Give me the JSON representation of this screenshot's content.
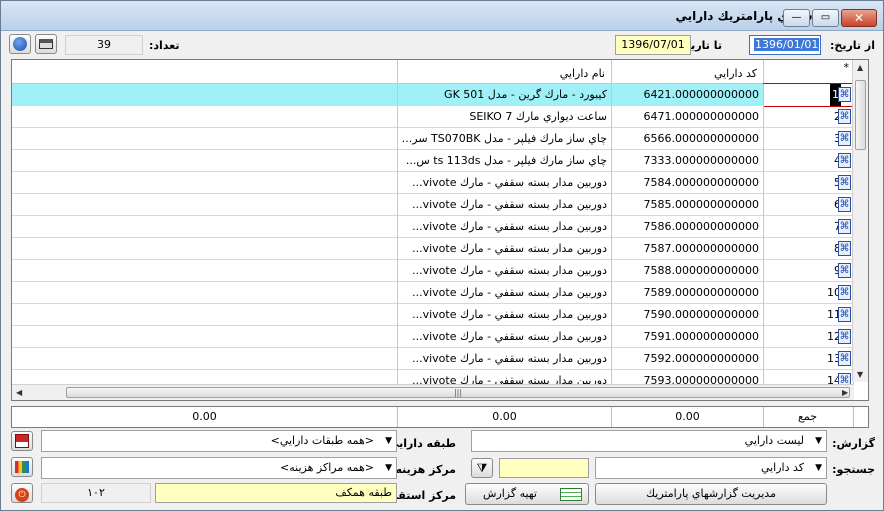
{
  "window": {
    "title": "گزارشهاي پارامتريك دارايي",
    "close_label": "✕",
    "max_label": "▭",
    "min_label": "—"
  },
  "filters": {
    "from_date_label": "از تاريخ:",
    "from_date_value": "1396/01/01",
    "to_date_label": "تا تاريخ:",
    "to_date_value": "1396/07/01",
    "count_label": "تعداد:",
    "count_value": "39"
  },
  "grid": {
    "columns": {
      "index": "*",
      "code": "كد دارايي",
      "name": "نام دارايي"
    },
    "rows": [
      {
        "idx": "1",
        "code": "6421.000000000000",
        "name": "كيبورد - مارك گرين - مدل GK 501",
        "selected": true
      },
      {
        "idx": "2",
        "code": "6471.000000000000",
        "name": "ساعت ديواري مارك SEIKO 7"
      },
      {
        "idx": "3",
        "code": "6566.000000000000",
        "name": "چاي ساز مارك فيلپر - مدل TS070BK سر..."
      },
      {
        "idx": "4",
        "code": "7333.000000000000",
        "name": "چاي ساز مارك فيلپر - مدل ts 113ds س..."
      },
      {
        "idx": "5",
        "code": "7584.000000000000",
        "name": "دوربين مدار بسته سقفي - مارك vivote..."
      },
      {
        "idx": "6",
        "code": "7585.000000000000",
        "name": "دوربين مدار بسته سقفي - مارك vivote..."
      },
      {
        "idx": "7",
        "code": "7586.000000000000",
        "name": "دوربين مدار بسته سقفي - مارك vivote..."
      },
      {
        "idx": "8",
        "code": "7587.000000000000",
        "name": "دوربين مدار بسته سقفي - مارك vivote..."
      },
      {
        "idx": "9",
        "code": "7588.000000000000",
        "name": "دوربين مدار بسته سقفي - مارك vivote..."
      },
      {
        "idx": "10",
        "code": "7589.000000000000",
        "name": "دوربين مدار بسته سقفي - مارك vivote..."
      },
      {
        "idx": "11",
        "code": "7590.000000000000",
        "name": "دوربين مدار بسته سقفي - مارك vivote..."
      },
      {
        "idx": "12",
        "code": "7591.000000000000",
        "name": "دوربين مدار بسته سقفي - مارك vivote..."
      },
      {
        "idx": "13",
        "code": "7592.000000000000",
        "name": "دوربين مدار بسته سقفي - مارك vivote..."
      },
      {
        "idx": "14",
        "code": "7593.000000000000",
        "name": "دوربين مدار بسته سقفي - مارك vivote..."
      }
    ]
  },
  "totals": {
    "label": "جمع",
    "code_total": "0.00",
    "name_total": "0.00",
    "extra_total": "0.00"
  },
  "form": {
    "report_label": "گزارش:",
    "report_value": "ليست دارايي",
    "asset_class_label": "طبقه دارايي:",
    "asset_class_value": "<همه طبقات دارايي>",
    "search_label": "جستجو:",
    "search_value": "كد دارايي",
    "cost_center_label": "مركز هزينه:",
    "cost_center_value": "<همه مراكز هزينه>",
    "location_label": "مركز استقرار:",
    "location_value": "طبقه همكف",
    "location_code": "۱۰۲",
    "manage_button": "مديريت گزارشهاي پارامتريك",
    "prepare_button": "تهيه گزارش"
  }
}
